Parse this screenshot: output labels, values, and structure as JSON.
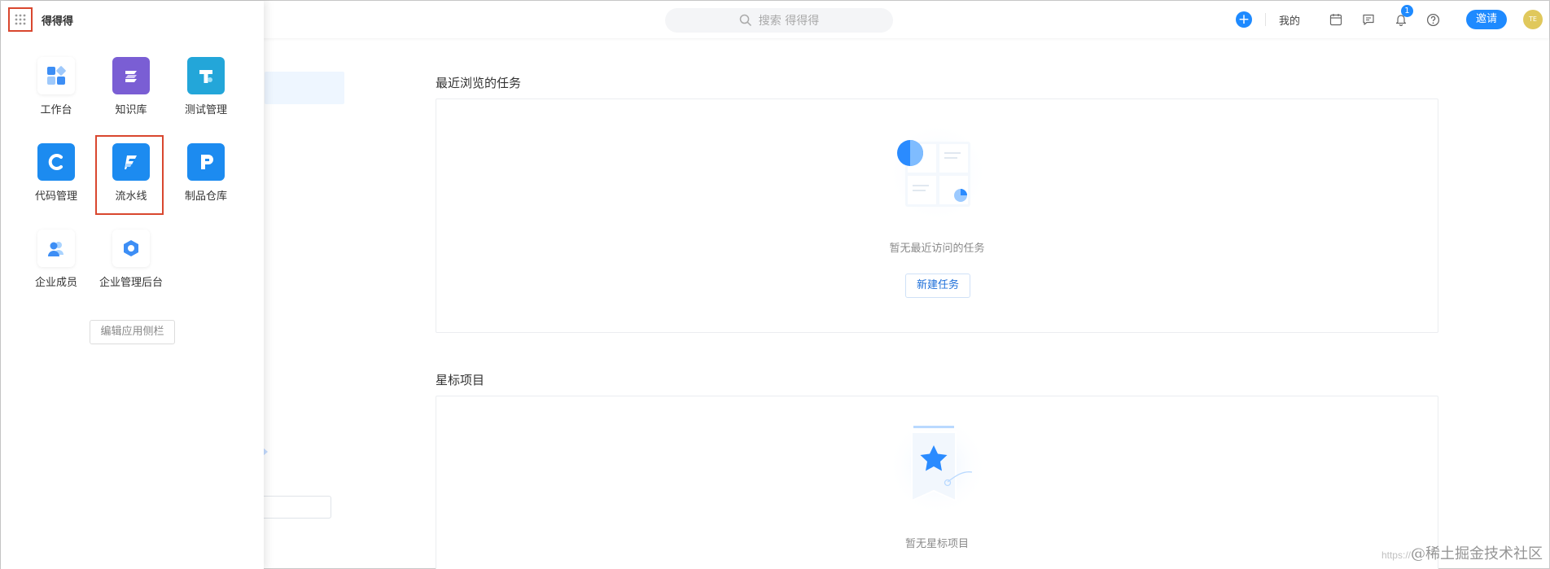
{
  "header": {
    "search_placeholder": "搜索 得得得",
    "mine_label": "我的",
    "notification_count": "1",
    "invite_label": "邀请",
    "avatar_initials": "TE",
    "accent_color": "#1e8aff"
  },
  "drawer": {
    "title": "得得得",
    "apps": [
      {
        "label": "工作台",
        "icon": "workbench-icon"
      },
      {
        "label": "知识库",
        "icon": "knowledge-base-icon"
      },
      {
        "label": "测试管理",
        "icon": "test-management-icon"
      },
      {
        "label": "代码管理",
        "icon": "code-management-icon"
      },
      {
        "label": "流水线",
        "icon": "pipeline-icon",
        "selected": true
      },
      {
        "label": "制品仓库",
        "icon": "artifact-repo-icon"
      },
      {
        "label": "企业成员",
        "icon": "enterprise-members-icon"
      },
      {
        "label": "企业管理后台",
        "icon": "enterprise-admin-icon"
      }
    ],
    "edit_label": "编辑应用侧栏"
  },
  "main": {
    "recent_tasks": {
      "title": "最近浏览的任务",
      "empty_text": "暂无最近访问的任务",
      "new_task_label": "新建任务"
    },
    "starred_projects": {
      "title": "星标项目",
      "empty_text": "暂无星标项目"
    }
  },
  "watermark": {
    "prefix": "https://",
    "text": "@稀土掘金技术社区"
  }
}
